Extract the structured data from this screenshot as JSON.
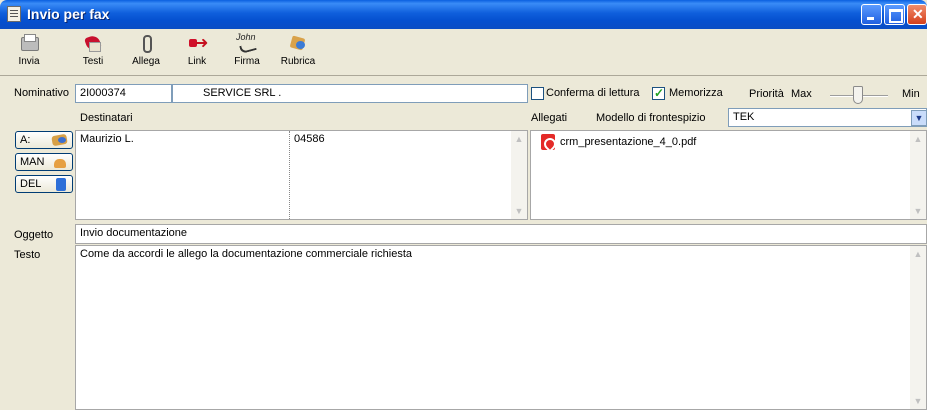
{
  "window": {
    "title": "Invio per fax"
  },
  "toolbar": {
    "items": [
      {
        "label": "Invia",
        "icon": "fax-machine-icon"
      },
      {
        "label": "Testi",
        "icon": "texts-book-icon"
      },
      {
        "label": "Allega",
        "icon": "paperclip-icon"
      },
      {
        "label": "Link",
        "icon": "link-arrow-icon"
      },
      {
        "label": "Firma",
        "icon": "signature-icon"
      },
      {
        "label": "Rubrica",
        "icon": "address-book-icon"
      }
    ]
  },
  "form": {
    "nominativo_label": "Nominativo",
    "nominativo_code": "2I000374",
    "nominativo_name": "SERVICE SRL .",
    "conferma_lettura_label": "Conferma di lettura",
    "conferma_lettura_checked": false,
    "memorizza_label": "Memorizza",
    "memorizza_checked": true,
    "priorita_label": "Priorità",
    "priorita_max": "Max",
    "priorita_min": "Min",
    "destinatari_label": "Destinatari",
    "allegati_label": "Allegati",
    "modello_label": "Modello di frontespizio",
    "modello_value": "TEK",
    "buttons": {
      "a": "A:",
      "man": "MAN",
      "del": "DEL"
    },
    "recipients": [
      {
        "name": "Maurizio L.",
        "fax": "04586"
      }
    ],
    "attachments": [
      "crm_presentazione_4_0.pdf"
    ],
    "oggetto_label": "Oggetto",
    "oggetto_value": "Invio documentazione",
    "testo_label": "Testo",
    "testo_value": "Come da accordi le allego la documentazione commerciale richiesta"
  }
}
